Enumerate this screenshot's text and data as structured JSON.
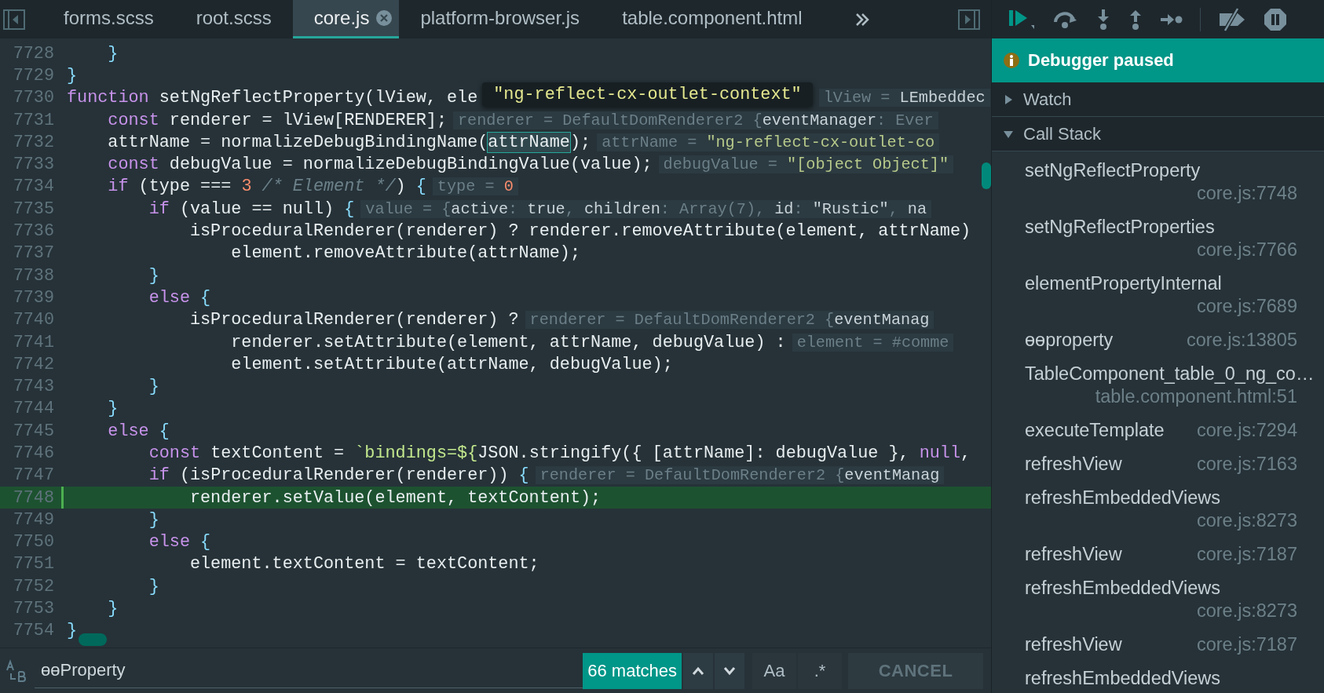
{
  "tabs": [
    {
      "label": "forms.scss",
      "selected": false
    },
    {
      "label": "root.scss",
      "selected": false
    },
    {
      "label": "core.js",
      "selected": true
    },
    {
      "label": "platform-browser.js",
      "selected": false
    },
    {
      "label": "table.component.html",
      "selected": false
    }
  ],
  "code_lines": [
    {
      "number": "7728",
      "current": false,
      "tokens": [
        {
          "kind": "punct",
          "text": "    }"
        }
      ]
    },
    {
      "number": "7729",
      "current": false,
      "tokens": [
        {
          "kind": "punct",
          "text": "}"
        }
      ]
    },
    {
      "number": "7730",
      "current": false,
      "tokens": [
        {
          "kind": "kw",
          "text": "function"
        },
        {
          "kind": "plain",
          "text": " setNgReflectProperty(lView, ele"
        }
      ],
      "tooltip": "\"ng-reflect-cx-outlet-context\"",
      "hint": [
        {
          "kind": "dim",
          "text": "lView = "
        },
        {
          "kind": "key",
          "text": "LEmbeddec"
        }
      ]
    },
    {
      "number": "7731",
      "current": false,
      "tokens": [
        {
          "kind": "kw",
          "text": "    const"
        },
        {
          "kind": "plain",
          "text": " renderer = lView[RENDERER];"
        }
      ],
      "hint": [
        {
          "kind": "dim",
          "text": "renderer = DefaultDomRenderer2 {"
        },
        {
          "kind": "key",
          "text": "eventManager"
        },
        {
          "kind": "dim",
          "text": ": Ever"
        }
      ]
    },
    {
      "number": "7732",
      "current": false,
      "tokens": [
        {
          "kind": "plain",
          "text": "    attrName = normalizeDebugBindingName("
        },
        {
          "kind": "match",
          "text": "attrName"
        },
        {
          "kind": "plain",
          "text": ");"
        }
      ],
      "hint": [
        {
          "kind": "dim",
          "text": "attrName = "
        },
        {
          "kind": "str",
          "text": "\"ng-reflect-cx-outlet-co"
        }
      ]
    },
    {
      "number": "7733",
      "current": false,
      "tokens": [
        {
          "kind": "kw",
          "text": "    const"
        },
        {
          "kind": "plain",
          "text": " debugValue = normalizeDebugBindingValue(value);"
        }
      ],
      "hint": [
        {
          "kind": "dim",
          "text": "debugValue = "
        },
        {
          "kind": "str",
          "text": "\"[object Object]\""
        }
      ]
    },
    {
      "number": "7734",
      "current": false,
      "tokens": [
        {
          "kind": "kw",
          "text": "    if"
        },
        {
          "kind": "plain",
          "text": " (type === "
        },
        {
          "kind": "num",
          "text": "3 "
        },
        {
          "kind": "comment",
          "text": "/* Element */"
        },
        {
          "kind": "plain",
          "text": ") "
        },
        {
          "kind": "punct",
          "text": "{"
        }
      ],
      "hint": [
        {
          "kind": "dim",
          "text": "type = "
        },
        {
          "kind": "num",
          "text": "0"
        }
      ]
    },
    {
      "number": "7735",
      "current": false,
      "tokens": [
        {
          "kind": "kw",
          "text": "        if"
        },
        {
          "kind": "plain",
          "text": " (value == null) "
        },
        {
          "kind": "punct",
          "text": "{"
        }
      ],
      "hint": [
        {
          "kind": "dim",
          "text": "value = {"
        },
        {
          "kind": "key",
          "text": "active"
        },
        {
          "kind": "dim",
          "text": ": "
        },
        {
          "kind": "key",
          "text": "true"
        },
        {
          "kind": "dim",
          "text": ", "
        },
        {
          "kind": "key",
          "text": "children"
        },
        {
          "kind": "dim",
          "text": ": Array(7), "
        },
        {
          "kind": "key",
          "text": "id"
        },
        {
          "kind": "dim",
          "text": ": "
        },
        {
          "kind": "key",
          "text": "\"Rustic\""
        },
        {
          "kind": "dim",
          "text": ", "
        },
        {
          "kind": "key",
          "text": "na"
        }
      ]
    },
    {
      "number": "7736",
      "current": false,
      "tokens": [
        {
          "kind": "plain",
          "text": "            isProceduralRenderer(renderer) ? renderer.removeAttribute(element, attrName)"
        }
      ]
    },
    {
      "number": "7737",
      "current": false,
      "tokens": [
        {
          "kind": "plain",
          "text": "                element.removeAttribute(attrName);"
        }
      ]
    },
    {
      "number": "7738",
      "current": false,
      "tokens": [
        {
          "kind": "punct",
          "text": "        }"
        }
      ]
    },
    {
      "number": "7739",
      "current": false,
      "tokens": [
        {
          "kind": "kw",
          "text": "        else"
        },
        {
          "kind": "punct",
          "text": " {"
        }
      ]
    },
    {
      "number": "7740",
      "current": false,
      "tokens": [
        {
          "kind": "plain",
          "text": "            isProceduralRenderer(renderer) ?"
        }
      ],
      "hint": [
        {
          "kind": "dim",
          "text": "renderer = DefaultDomRenderer2 {"
        },
        {
          "kind": "key",
          "text": "eventManag"
        }
      ]
    },
    {
      "number": "7741",
      "current": false,
      "tokens": [
        {
          "kind": "plain",
          "text": "                renderer.setAttribute(element, attrName, debugValue) :"
        }
      ],
      "hint": [
        {
          "kind": "dim",
          "text": "element = #comme"
        }
      ]
    },
    {
      "number": "7742",
      "current": false,
      "tokens": [
        {
          "kind": "plain",
          "text": "                element.setAttribute(attrName, debugValue);"
        }
      ]
    },
    {
      "number": "7743",
      "current": false,
      "tokens": [
        {
          "kind": "punct",
          "text": "        }"
        }
      ]
    },
    {
      "number": "7744",
      "current": false,
      "tokens": [
        {
          "kind": "punct",
          "text": "    }"
        }
      ]
    },
    {
      "number": "7745",
      "current": false,
      "tokens": [
        {
          "kind": "kw",
          "text": "    else"
        },
        {
          "kind": "punct",
          "text": " {"
        }
      ]
    },
    {
      "number": "7746",
      "current": false,
      "tokens": [
        {
          "kind": "kw",
          "text": "        const"
        },
        {
          "kind": "plain",
          "text": " textContent = "
        },
        {
          "kind": "str",
          "text": "`bindings=${"
        },
        {
          "kind": "plain",
          "text": "JSON.stringify({ [attrName]: debugValue }, "
        },
        {
          "kind": "kw",
          "text": "null"
        },
        {
          "kind": "plain",
          "text": ","
        }
      ]
    },
    {
      "number": "7747",
      "current": false,
      "tokens": [
        {
          "kind": "kw",
          "text": "        if"
        },
        {
          "kind": "plain",
          "text": " (isProceduralRenderer(renderer)) "
        },
        {
          "kind": "punct",
          "text": "{"
        }
      ],
      "hint": [
        {
          "kind": "dim",
          "text": "renderer = DefaultDomRenderer2 {"
        },
        {
          "kind": "key",
          "text": "eventManag"
        }
      ]
    },
    {
      "number": "7748",
      "current": true,
      "tokens": [
        {
          "kind": "plain",
          "text": "            renderer.setValue(element, textContent);"
        }
      ]
    },
    {
      "number": "7749",
      "current": false,
      "tokens": [
        {
          "kind": "punct",
          "text": "        }"
        }
      ]
    },
    {
      "number": "7750",
      "current": false,
      "tokens": [
        {
          "kind": "kw",
          "text": "        else"
        },
        {
          "kind": "punct",
          "text": " {"
        }
      ]
    },
    {
      "number": "7751",
      "current": false,
      "tokens": [
        {
          "kind": "plain",
          "text": "            element.textContent = textContent;"
        }
      ]
    },
    {
      "number": "7752",
      "current": false,
      "tokens": [
        {
          "kind": "punct",
          "text": "        }"
        }
      ]
    },
    {
      "number": "7753",
      "current": false,
      "tokens": [
        {
          "kind": "punct",
          "text": "    }"
        }
      ]
    },
    {
      "number": "7754",
      "current": false,
      "tokens": [
        {
          "kind": "punct",
          "text": "}"
        }
      ]
    }
  ],
  "search": {
    "value": "ɵɵProperty",
    "matches": "66 matches",
    "case_button": "Aa",
    "regex_button": ".*",
    "cancel": "CANCEL"
  },
  "debugger": {
    "status": "Debugger paused",
    "sections": [
      {
        "title": "Watch",
        "expanded": false
      },
      {
        "title": "Call Stack",
        "expanded": true
      }
    ],
    "call_stack": [
      {
        "name": "setNgReflectProperty",
        "location": "core.js:7748"
      },
      {
        "name": "setNgReflectProperties",
        "location": "core.js:7766"
      },
      {
        "name": "elementPropertyInternal",
        "location": "core.js:7689"
      },
      {
        "name": "ɵɵproperty",
        "location": "core.js:13805"
      },
      {
        "name": "TableComponent_table_0_ng_co…",
        "location": "table.component.html:51"
      },
      {
        "name": "executeTemplate",
        "location": "core.js:7294"
      },
      {
        "name": "refreshView",
        "location": "core.js:7163"
      },
      {
        "name": "refreshEmbeddedViews",
        "location": "core.js:8273"
      },
      {
        "name": "refreshView",
        "location": "core.js:7187"
      },
      {
        "name": "refreshEmbeddedViews",
        "location": "core.js:8273"
      },
      {
        "name": "refreshView",
        "location": "core.js:7187"
      },
      {
        "name": "refreshEmbeddedViews"
      }
    ]
  }
}
